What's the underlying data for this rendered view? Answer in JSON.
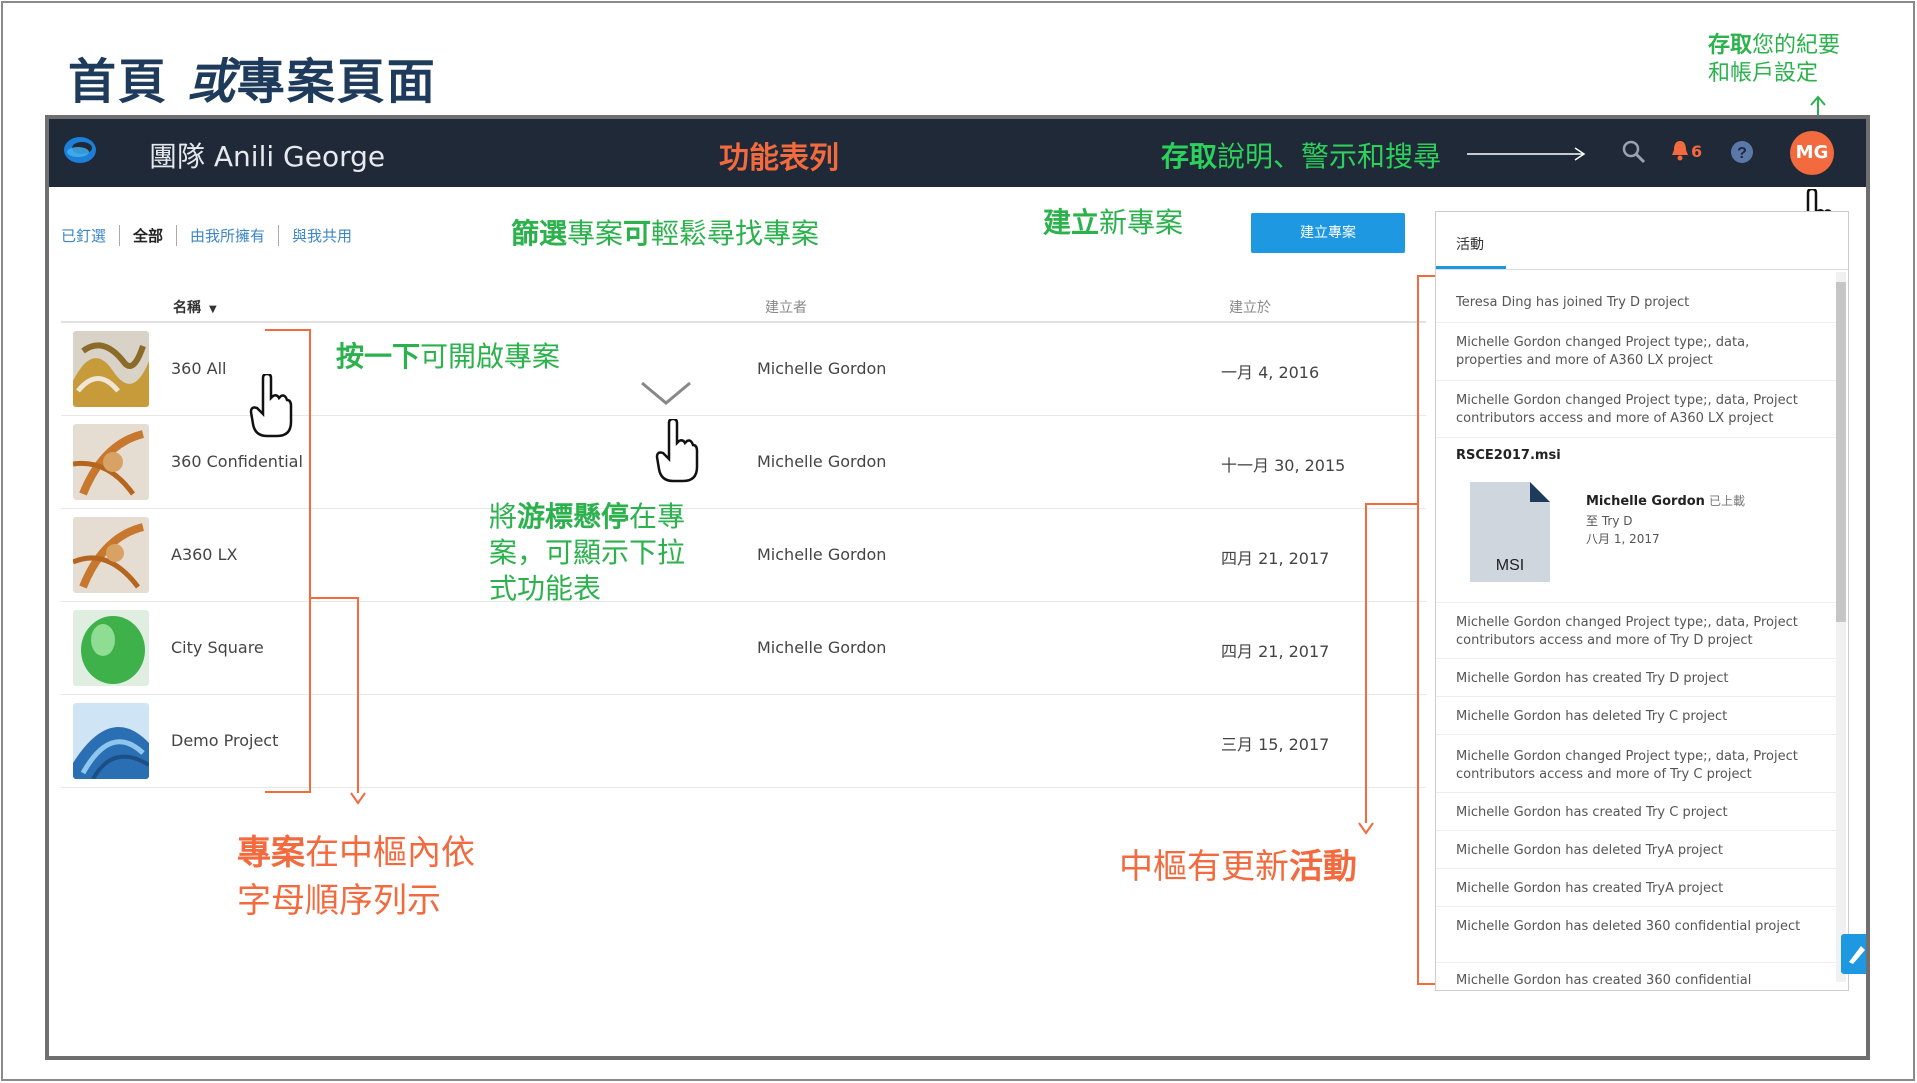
{
  "page": {
    "title_part1": "首頁",
    "title_part2": "或",
    "title_part3": "專案頁面",
    "top_right_note_bold": "存取",
    "top_right_note_rest": "您的紀要",
    "top_right_note_line2": "和帳戶設定"
  },
  "header": {
    "team": "團隊 Anili George",
    "label": "功能表列",
    "access_bold": "存取",
    "access_rest": "說明、警示和搜尋",
    "notification_count": "6",
    "avatar_initials": "MG",
    "icons": [
      "logo-icon",
      "search-icon",
      "bell-icon",
      "help-icon"
    ]
  },
  "filters": [
    "已釘選",
    "全部",
    "由我所擁有",
    "與我共用"
  ],
  "annotations": {
    "filter_bold": "篩選",
    "filter_rest": "專案",
    "filter_bold2": "可",
    "filter_rest2": "輕鬆尋找專案",
    "create_bold": "建立",
    "create_rest": "新專案",
    "open_project": "按一下",
    "open_project_rest": "可開啟專案",
    "hover_line1_a": "將",
    "hover_line1_b": "游標懸停",
    "hover_line1_c": "在專",
    "hover_line2": "案，可顯示下拉",
    "hover_line3": "式功能表",
    "alpha_line1_bold": "專案",
    "alpha_line1_rest": "在中樞內依",
    "alpha_line2": "字母順序列示",
    "activity_note_rest": "中樞有更新",
    "activity_note_bold": "活動"
  },
  "create_button": "建立專案",
  "columns": {
    "name": "名稱",
    "creator": "建立者",
    "created": "建立於"
  },
  "projects": [
    {
      "name": "360 All",
      "creator": "Michelle Gordon",
      "date": "一月 4, 2016"
    },
    {
      "name": "360 Confidential",
      "creator": "Michelle Gordon",
      "date": "十一月 30, 2015"
    },
    {
      "name": "A360 LX",
      "creator": "Michelle Gordon",
      "date": "四月 21, 2017"
    },
    {
      "name": "City Square",
      "creator": "Michelle Gordon",
      "date": "四月 21, 2017"
    },
    {
      "name": "Demo Project",
      "creator": "",
      "date": "三月 15, 2017"
    }
  ],
  "activity": {
    "tab": "活動",
    "items": [
      "Teresa Ding has joined Try D project",
      "Michelle Gordon changed Project type;, data, properties and more of A360 LX project",
      "Michelle Gordon changed Project type;, data, Project contributors access and more of A360 LX project",
      "Michelle Gordon changed Project type;, data, Project contributors access and more of Try D project",
      "Michelle Gordon has created Try D project",
      "Michelle Gordon has deleted Try C project",
      "Michelle Gordon changed Project type;, data, Project contributors access and more of Try C project",
      "Michelle Gordon has created Try C project",
      "Michelle Gordon has deleted TryA project",
      "Michelle Gordon has created TryA project",
      "Michelle Gordon has deleted 360 confidential project",
      "Michelle Gordon has created 360 confidential"
    ],
    "file": {
      "name": "RSCE2017.msi",
      "label": "MSI",
      "user": "Michelle Gordon",
      "action": "已上載",
      "to": "至 Try D",
      "date": "八月 1, 2017"
    }
  }
}
